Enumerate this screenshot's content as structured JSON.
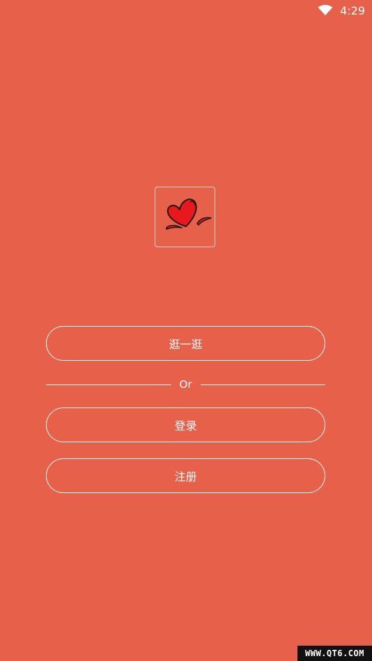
{
  "status_bar": {
    "time": "4:29",
    "wifi_icon": "wifi-icon"
  },
  "logo": {
    "icon": "heart-icon"
  },
  "buttons": {
    "browse_label": "逛一逛",
    "login_label": "登录",
    "register_label": "注册"
  },
  "divider": {
    "label": "Or"
  },
  "watermark": {
    "text": "WWW.QT6.COM"
  },
  "colors": {
    "background": "#E6604A",
    "foreground": "#FFFFFF",
    "heart": "#E8181C"
  }
}
